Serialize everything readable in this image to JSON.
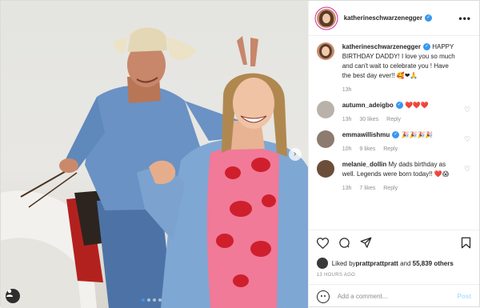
{
  "post": {
    "author": "katherineschwarzenegger",
    "more_label": "•••"
  },
  "caption": {
    "username": "katherineschwarzenegger",
    "text": " HAPPY BIRTHDAY DADDY! I love you so much and can't wait to celebrate you ! Have the best day ever!! 🥰❤🙏",
    "time": "13h"
  },
  "comments": [
    {
      "username": "autumn_adeigbo",
      "text": " ❤️❤️❤️",
      "time": "13h",
      "likes": "30 likes",
      "reply": "Reply",
      "avatar_color": "#b9b2ab",
      "verified": true
    },
    {
      "username": "emmawillishmu",
      "text": " 🎉🎉🎉🎉",
      "time": "10h",
      "likes": "9 likes",
      "reply": "Reply",
      "avatar_color": "#8c7b6e",
      "verified": true
    },
    {
      "username": "melanie_dollin",
      "text": " My dads birthday as well. Legends were born today!! ❤️😱",
      "time": "13h",
      "likes": "7 likes",
      "reply": "Reply",
      "avatar_color": "#6b4e3a",
      "verified": false
    }
  ],
  "likes": {
    "prefix": "Liked by ",
    "user": "prattprattpratt",
    "middle": " and ",
    "count": "55,839 others"
  },
  "timestamp": "13 HOURS AGO",
  "add_comment": {
    "placeholder": "Add a comment...",
    "post_label": "Post"
  },
  "carousel": {
    "slides": 4,
    "active": 0,
    "next_glyph": "›"
  },
  "colors": {
    "accent": "#3897f0",
    "text": "#262626",
    "muted": "#8e8e8e",
    "post_disabled": "#b2dffc"
  }
}
